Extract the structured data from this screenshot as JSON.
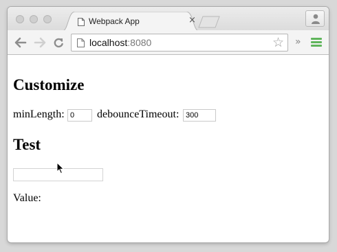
{
  "browser": {
    "tab": {
      "title": "Webpack App",
      "close_glyph": "×",
      "favicon": "page-icon"
    },
    "address": {
      "host": "localhost",
      "port": ":8080"
    },
    "toolbar": {
      "back_icon": "back-arrow-icon",
      "forward_icon": "forward-arrow-icon",
      "reload_icon": "reload-icon",
      "star_glyph": "☆",
      "overflow_glyph": "»",
      "menu_icon": "hamburger-menu-icon",
      "menu_color": "#5fb55b"
    },
    "profile_icon": "person-icon"
  },
  "page": {
    "customize_heading": "Customize",
    "min_length_label": "minLength:",
    "min_length_value": "0",
    "debounce_label": "debounceTimeout:",
    "debounce_value": "300",
    "test_heading": "Test",
    "test_input_value": "",
    "value_label": "Value:"
  }
}
